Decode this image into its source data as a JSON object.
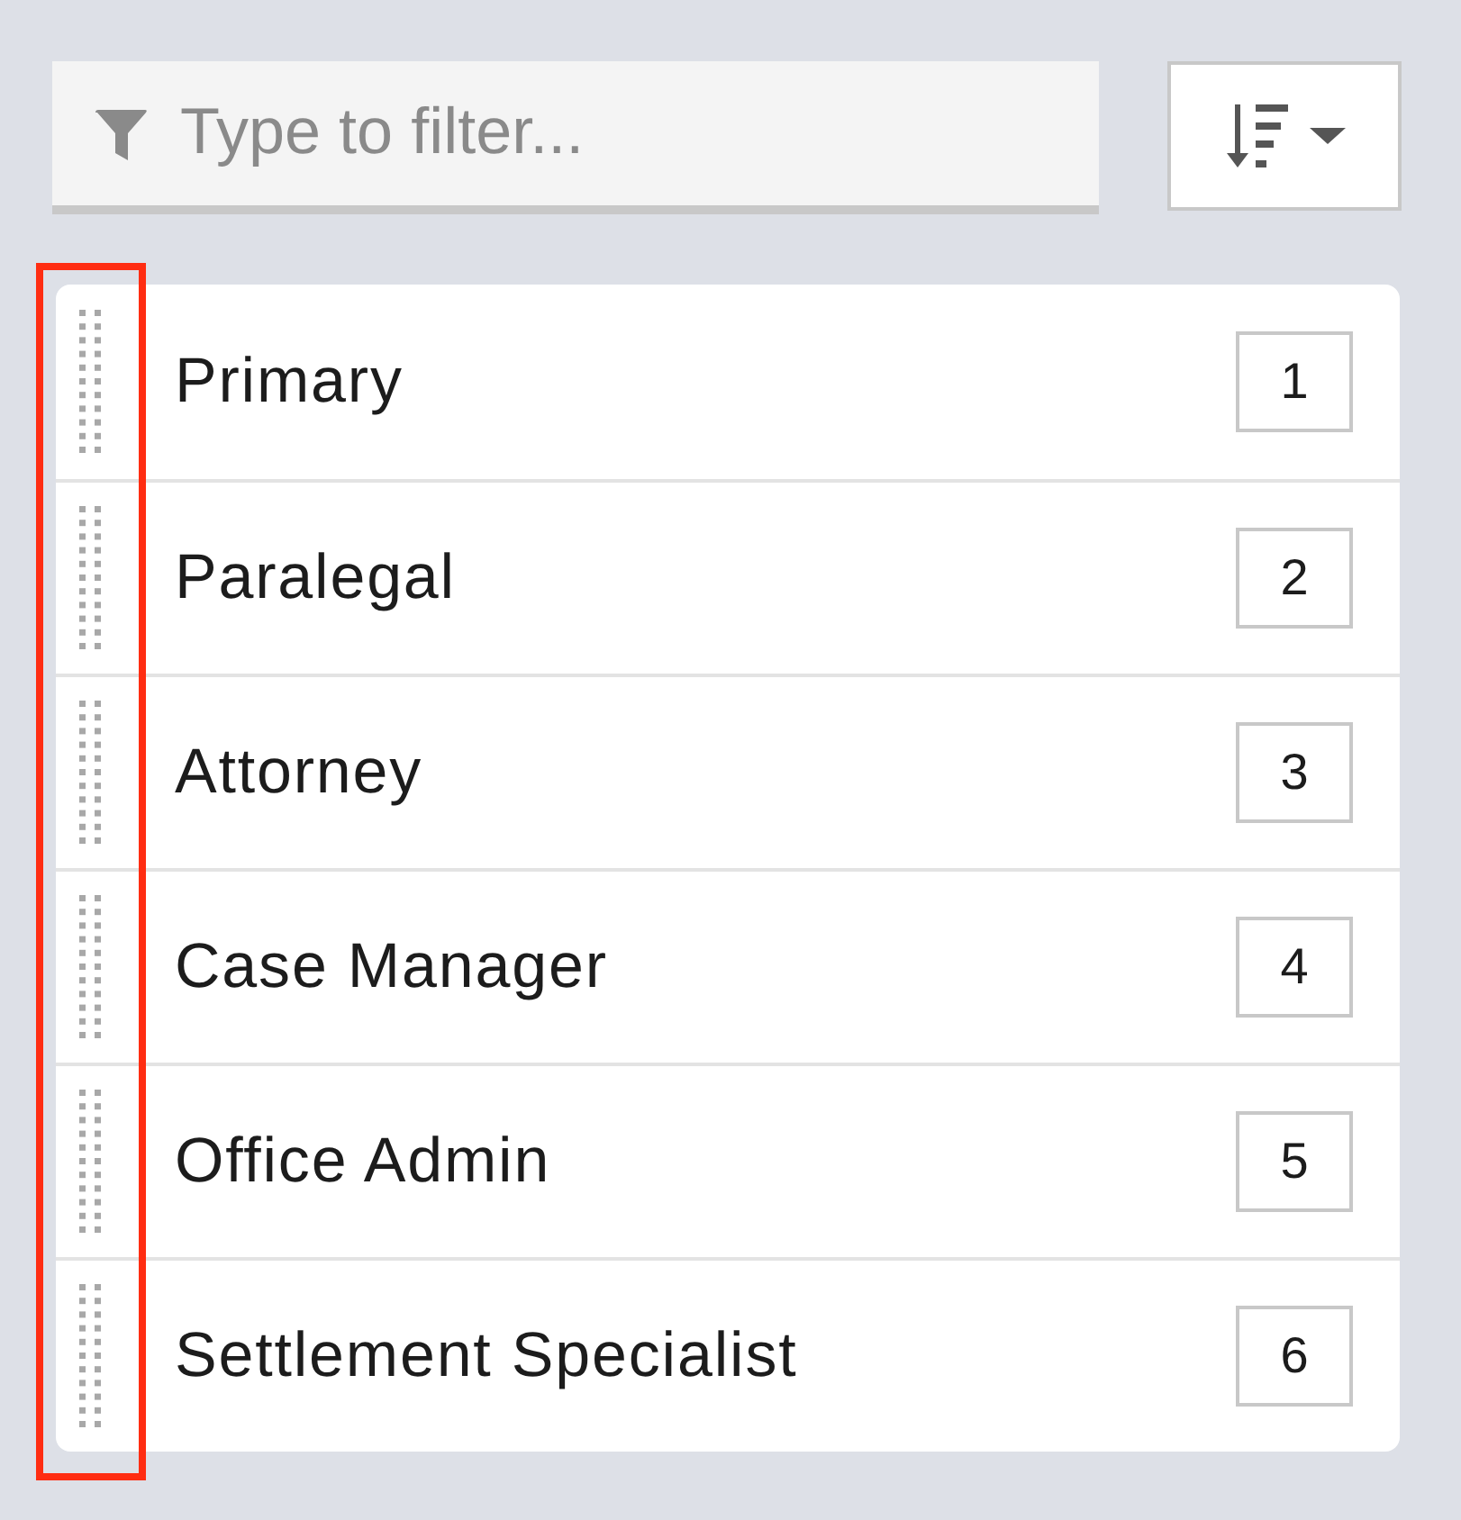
{
  "filter": {
    "placeholder": "Type to filter..."
  },
  "items": [
    {
      "label": "Primary",
      "order": "1"
    },
    {
      "label": "Paralegal",
      "order": "2"
    },
    {
      "label": "Attorney",
      "order": "3"
    },
    {
      "label": "Case Manager",
      "order": "4"
    },
    {
      "label": "Office Admin",
      "order": "5"
    },
    {
      "label": "Settlement Specialist",
      "order": "6"
    }
  ],
  "highlight": {
    "kind": "handle_column"
  }
}
